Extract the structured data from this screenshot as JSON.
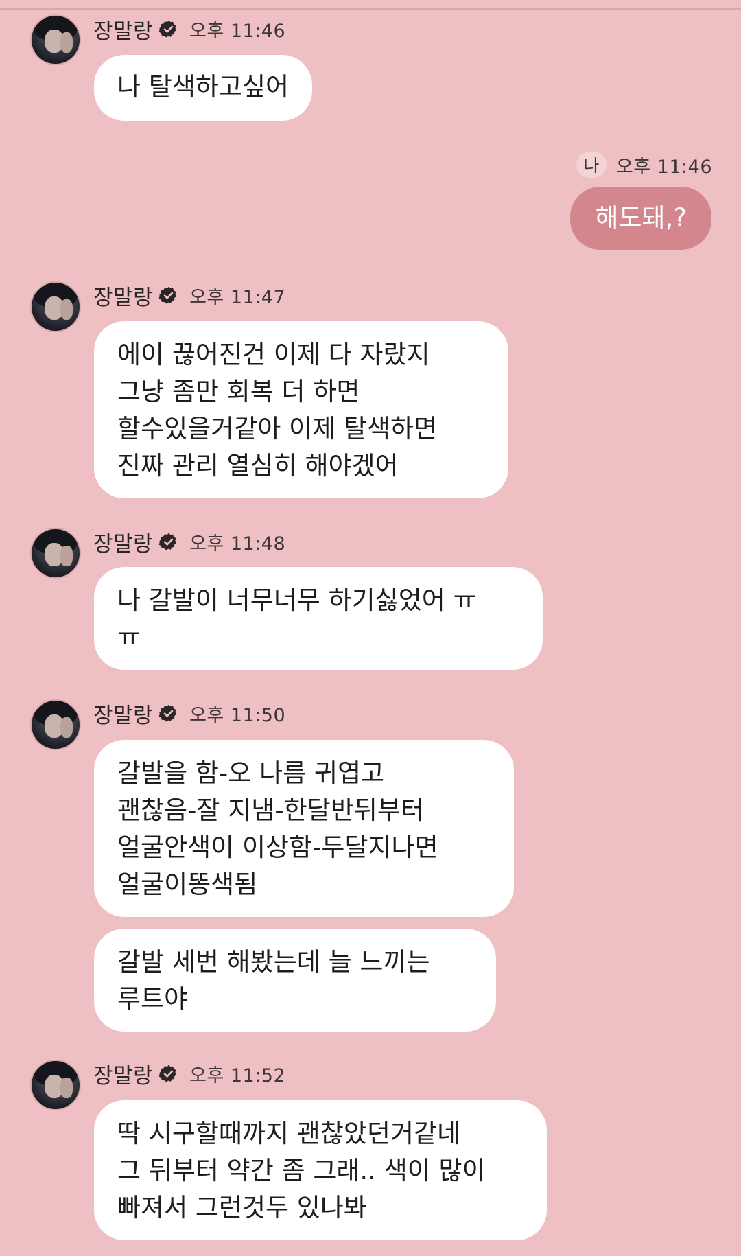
{
  "chat": {
    "sender": "장말랑",
    "me_label": "나",
    "messages": [
      {
        "time": "오후 11:46",
        "text": "나 탈색하고싶어"
      },
      {
        "time": "오후 11:46",
        "text": "해도돼,?"
      },
      {
        "time": "오후 11:47",
        "text": "에이 끊어진건 이제 다 자랐지\n그냥 좀만 회복 더 하면\n할수있을거같아 이제 탈색하면\n진짜 관리 열심히 해야겠어"
      },
      {
        "time": "오후 11:48",
        "text": "나 갈발이 너무너무 하기싫었어 ㅠ\nㅠ"
      },
      {
        "time": "오후 11:50",
        "text": "갈발을 함-오 나름 귀엽고\n괜찮음-잘 지냄-한달반뒤부터\n얼굴안색이 이상함-두달지나면\n얼굴이똥색됨"
      },
      {
        "text": "갈발 세번 해봤는데 늘 느끼는\n루트야"
      },
      {
        "time": "오후 11:52",
        "text": "딱 시구할때까지 괜찮았던거같네\n그 뒤부터 약간 좀 그래.. 색이 많이\n빠져서 그런것두 있나봐"
      }
    ]
  },
  "colors": {
    "background": "#eec0c3",
    "incoming_bubble": "#ffffff",
    "outgoing_bubble": "#d3868d"
  }
}
